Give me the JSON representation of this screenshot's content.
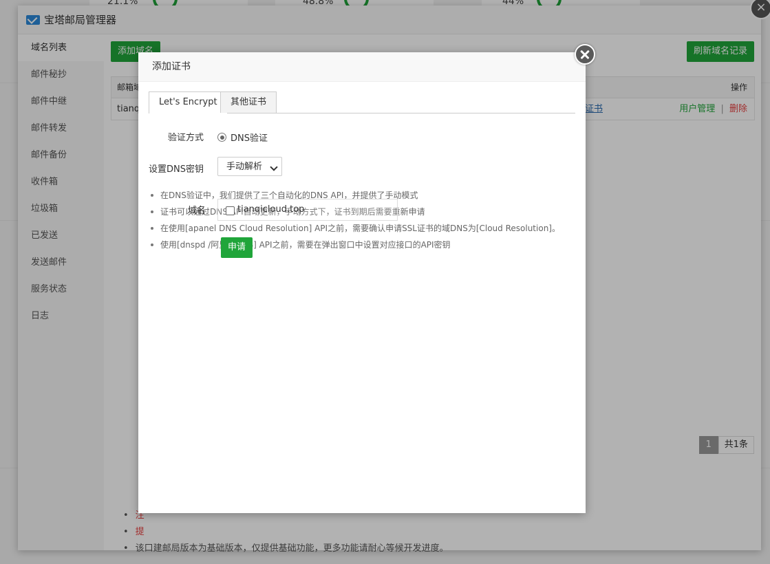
{
  "app": {
    "title": "宝塔邮局管理器"
  },
  "background": {
    "percents": [
      "21.1%",
      "48.8%",
      "44%"
    ]
  },
  "sidebar": {
    "items": [
      {
        "label": "域名列表",
        "active": true
      },
      {
        "label": "邮件秘抄"
      },
      {
        "label": "邮件中继"
      },
      {
        "label": "邮件转发"
      },
      {
        "label": "邮件备份"
      },
      {
        "label": "收件箱"
      },
      {
        "label": "垃圾箱"
      },
      {
        "label": "已发送"
      },
      {
        "label": "发送邮件"
      },
      {
        "label": "服务状态"
      },
      {
        "label": "日志"
      }
    ]
  },
  "main": {
    "add_domain_label": "添加域名",
    "refresh_label": "刷新域名记录",
    "table": {
      "header_first": "邮箱域",
      "header_action": "操作",
      "row_domain": "tianqi",
      "row_cert_link": "证书",
      "row_user_manage": "用户管理",
      "row_separator": "|",
      "row_delete": "删除"
    },
    "pagination": {
      "current": "1",
      "total": "共1条"
    },
    "bottom_tip": "该口建邮局版本为基础版本，仅提供基础功能，更多功能请耐心等候开发进度。"
  },
  "dialog": {
    "title": "添加证书",
    "tabs": [
      "Let's Encrypt",
      "其他证书"
    ],
    "verify_label": "验证方式",
    "verify_option": "DNS验证",
    "dns_key_label": "设置DNS密钥",
    "dns_select_value": "手动解析",
    "tips": [
      "在DNS验证中，我们提供了三个自动化的DNS API，并提供了手动模式",
      "证书可以通过DNS API自动更新，手动方式下，证书到期后需要重新申请",
      "在使用[apanel DNS Cloud Resolution] API之前，需要确认申请SSL证书的域DNS为[Cloud Resolution]。",
      "使用[dnspd /阿里云DNS] API之前，需要在弹出窗口中设置对应接口的API密钥"
    ],
    "domain_label": "域名",
    "domain_value": "tianqicloud.top",
    "apply_label": "申请"
  },
  "colors": {
    "accent_green": "#20a53a",
    "danger_red": "#e64040",
    "overlay": "rgba(0,0,0,0.3)"
  }
}
